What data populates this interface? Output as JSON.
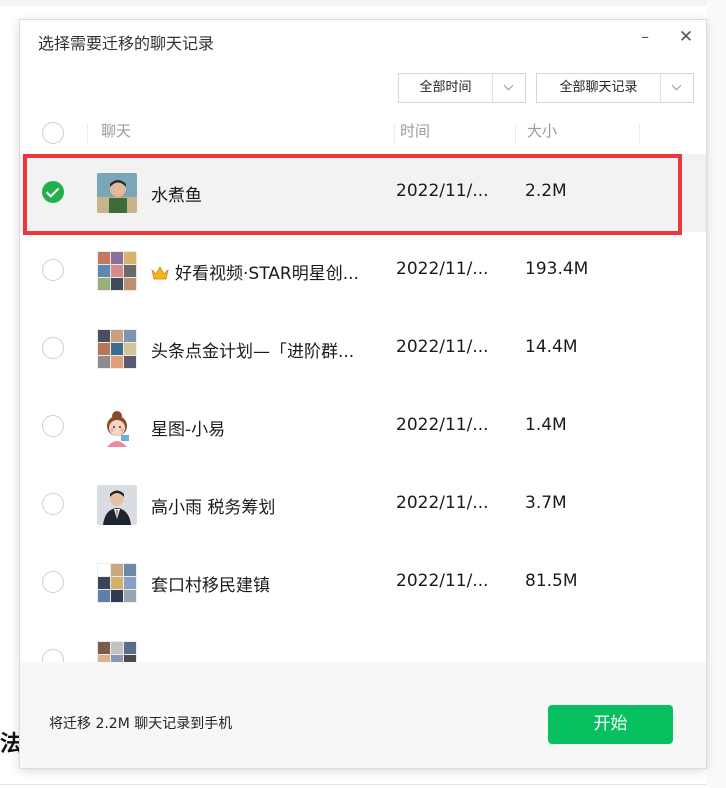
{
  "background": {
    "glyph": "法"
  },
  "dialog": {
    "title": "选择需要迁移的聊天记录",
    "minimize_icon": "minimize-icon",
    "close_icon": "close-icon",
    "filters": {
      "time": "全部时间",
      "chat": "全部聊天记录"
    },
    "columns": {
      "chat": "聊天",
      "time": "时间",
      "size": "大小"
    },
    "rows": [
      {
        "name": "水煮鱼",
        "time": "2022/11/...",
        "size": "2.2M",
        "checked": true
      },
      {
        "name": "好看视频·STAR明星创...",
        "time": "2022/11/...",
        "size": "193.4M",
        "checked": false,
        "crown": true
      },
      {
        "name": "头条点金计划—「进阶群...",
        "time": "2022/11/...",
        "size": "14.4M",
        "checked": false
      },
      {
        "name": "星图-小易",
        "time": "2022/11/...",
        "size": "1.4M",
        "checked": false
      },
      {
        "name": "高小雨 税务筹划",
        "time": "2022/11/...",
        "size": "3.7M",
        "checked": false
      },
      {
        "name": "套口村移民建镇",
        "time": "2022/11/...",
        "size": "81.5M",
        "checked": false
      },
      {
        "name": "",
        "time": "",
        "size": "",
        "checked": false
      }
    ],
    "footer": {
      "summary": "将迁移 2.2M 聊天记录到手机",
      "start_label": "开始"
    },
    "colors": {
      "accent": "#07c160",
      "check": "#20b14a",
      "highlight": "#e8393c"
    }
  }
}
